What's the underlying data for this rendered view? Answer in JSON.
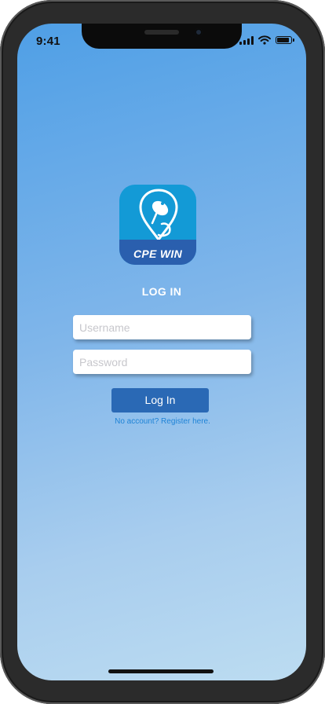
{
  "status_bar": {
    "time": "9:41",
    "signal_icon": "cellular-signal-icon",
    "wifi_icon": "wifi-icon",
    "battery_icon": "battery-icon"
  },
  "logo": {
    "text": "CPE WIN",
    "icon": "map-pin-satellite-dish-icon"
  },
  "login": {
    "title": "LOG IN",
    "username_placeholder": "Username",
    "username_value": "",
    "password_placeholder": "Password",
    "password_value": "",
    "button_label": "Log In",
    "register_link": "No account? Register here."
  },
  "colors": {
    "gradient_top": "#4f9fe6",
    "gradient_bottom": "#bcdcf1",
    "logo_bg": "#139ad6",
    "logo_band": "#2a5fae",
    "button_bg": "#2a69b5",
    "link_color": "#1f83d6"
  }
}
